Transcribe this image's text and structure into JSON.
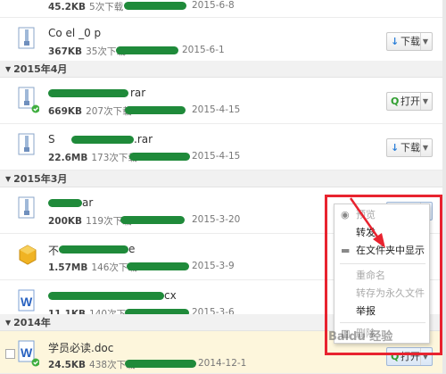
{
  "rows": [
    {
      "name": "",
      "size": "45.2KB",
      "downloads": "5次下载",
      "date": "2015-6-8",
      "icon": "orange-file-icon",
      "button": ""
    },
    {
      "name": "Co    el  _0  p",
      "size": "367KB",
      "downloads": "35次下载",
      "date": "2015-6-1",
      "icon": "zip-file-icon",
      "button": "下载"
    },
    {
      "name": "",
      "size": "669KB",
      "downloads": "207次下载",
      "date": "2015-4-15",
      "icon": "zip-file-icon",
      "button": "打开",
      "suffix": "rar"
    },
    {
      "name": "S    ",
      "size": "22.6MB",
      "downloads": "173次下载",
      "date": "2015-4-15",
      "icon": "zip-file-icon",
      "button": "下载",
      "suffix": ".rar"
    },
    {
      "name": "",
      "size": "200KB",
      "downloads": "119次下载",
      "date": "2015-3-20",
      "icon": "zip-file-icon",
      "button": "",
      "suffix": "ar"
    },
    {
      "name": "不",
      "size": "1.57MB",
      "downloads": "146次下载",
      "date": "2015-3-9",
      "icon": "package-icon",
      "button": "",
      "suffix": "e"
    },
    {
      "name": "",
      "size": "11.1KB",
      "downloads": "140次下载",
      "date": "2015-3-6",
      "icon": "word-doc-icon",
      "button": "",
      "suffix": "cx"
    },
    {
      "name": "学员必读.doc",
      "size": "24.5KB",
      "downloads": "438次下载",
      "date": "2014-12-1",
      "icon": "word-doc-icon",
      "button": "打开"
    }
  ],
  "groups": [
    "2015年4月",
    "2015年3月",
    "2014年"
  ],
  "menu": {
    "items": [
      "预览",
      "转发",
      "在文件夹中显示",
      "重命名",
      "转存为永久文件",
      "举报",
      "删除"
    ]
  },
  "watermark": "Baidu 经验",
  "colors": {
    "accent": "#2b7fd8",
    "highlight": "#e8232f",
    "open": "#2f9e2f"
  }
}
